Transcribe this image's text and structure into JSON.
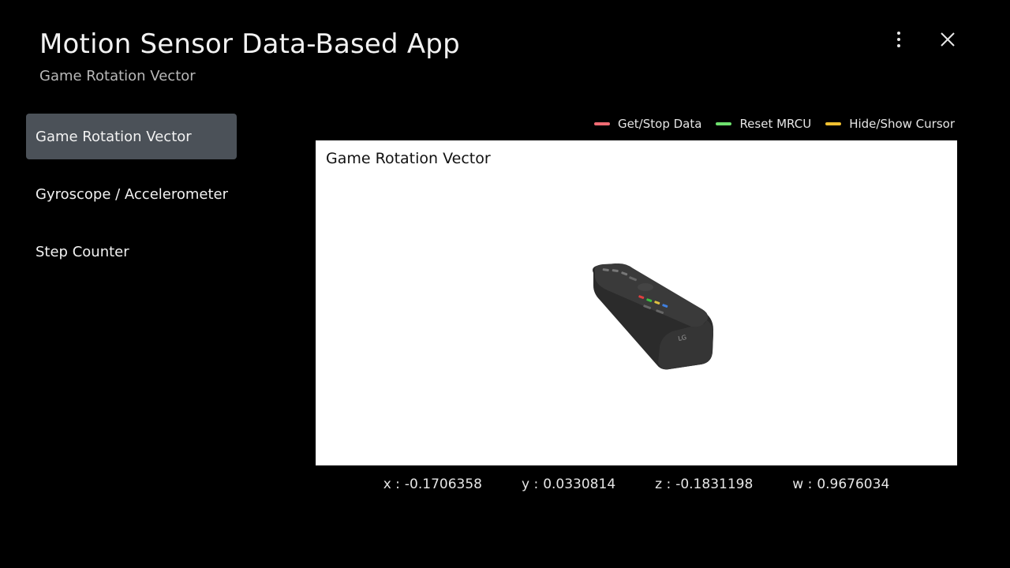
{
  "header": {
    "title": "Motion Sensor Data-Based App",
    "subtitle": "Game Rotation Vector",
    "menu_icon": "more-vertical-icon",
    "close_icon": "close-icon"
  },
  "sidebar": {
    "items": [
      {
        "label": "Game Rotation Vector",
        "active": true
      },
      {
        "label": "Gyroscope / Accelerometer",
        "active": false
      },
      {
        "label": "Step Counter",
        "active": false
      }
    ]
  },
  "legend": {
    "items": [
      {
        "label": "Get/Stop Data",
        "color": "#f06b73"
      },
      {
        "label": "Reset MRCU",
        "color": "#6ee06e"
      },
      {
        "label": "Hide/Show Cursor",
        "color": "#f0c030"
      }
    ]
  },
  "panel": {
    "title": "Game Rotation Vector",
    "remote_logo": "LG"
  },
  "readouts": {
    "x": {
      "label": "x :",
      "value": "-0.1706358"
    },
    "y": {
      "label": "y :",
      "value": "0.0330814"
    },
    "z": {
      "label": "z :",
      "value": "-0.1831198"
    },
    "w": {
      "label": "w :",
      "value": "0.9676034"
    }
  }
}
